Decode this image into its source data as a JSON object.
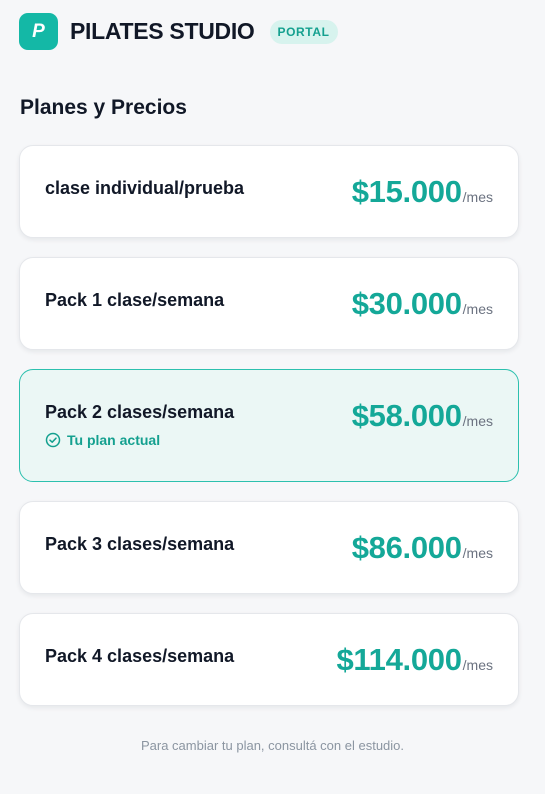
{
  "header": {
    "logo_letter": "P",
    "brand": "PILATES STUDIO",
    "badge": "PORTAL"
  },
  "section_title": "Planes y Precios",
  "plans": [
    {
      "name": "clase individual/prueba",
      "price": "$15.000",
      "period": "/mes",
      "current": false
    },
    {
      "name": "Pack 1 clase/semana",
      "price": "$30.000",
      "period": "/mes",
      "current": false
    },
    {
      "name": "Pack 2 clases/semana",
      "price": "$58.000",
      "period": "/mes",
      "current": true,
      "current_label": "Tu plan actual"
    },
    {
      "name": "Pack 3 clases/semana",
      "price": "$86.000",
      "period": "/mes",
      "current": false
    },
    {
      "name": "Pack 4 clases/semana",
      "price": "$114.000",
      "period": "/mes",
      "current": false
    }
  ],
  "footnote": "Para cambiar tu plan, consultá con el estudio.",
  "colors": {
    "accent": "#14b8a6",
    "price": "#14a898",
    "current_bg": "#ebf7f5",
    "current_border": "#2cc0ae"
  }
}
